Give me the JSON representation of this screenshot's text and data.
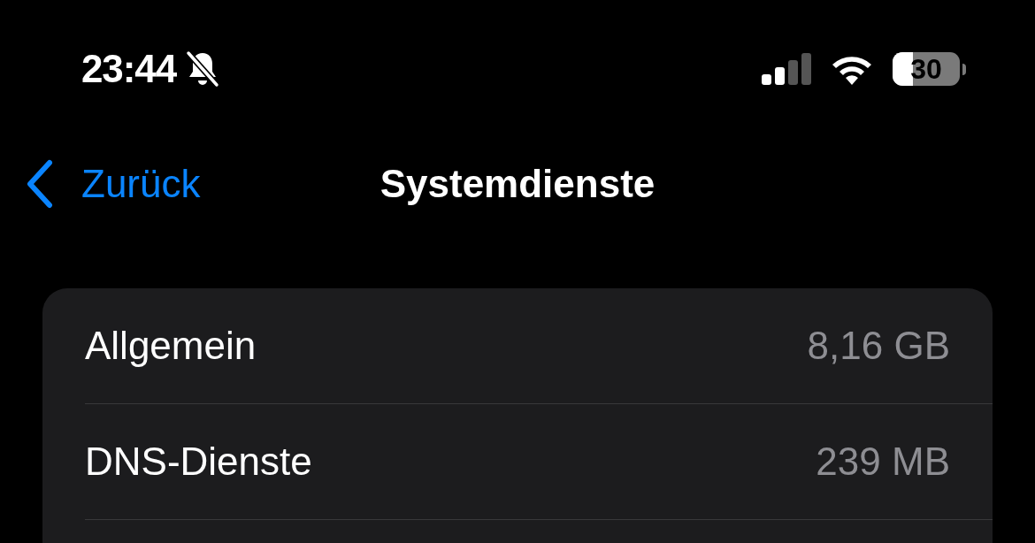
{
  "status_bar": {
    "time": "23:44",
    "battery": "30"
  },
  "nav": {
    "back": "Zurück",
    "title": "Systemdienste"
  },
  "rows": [
    {
      "label": "Allgemein",
      "value": "8,16 GB"
    },
    {
      "label": "DNS-Dienste",
      "value": "239 MB"
    }
  ]
}
